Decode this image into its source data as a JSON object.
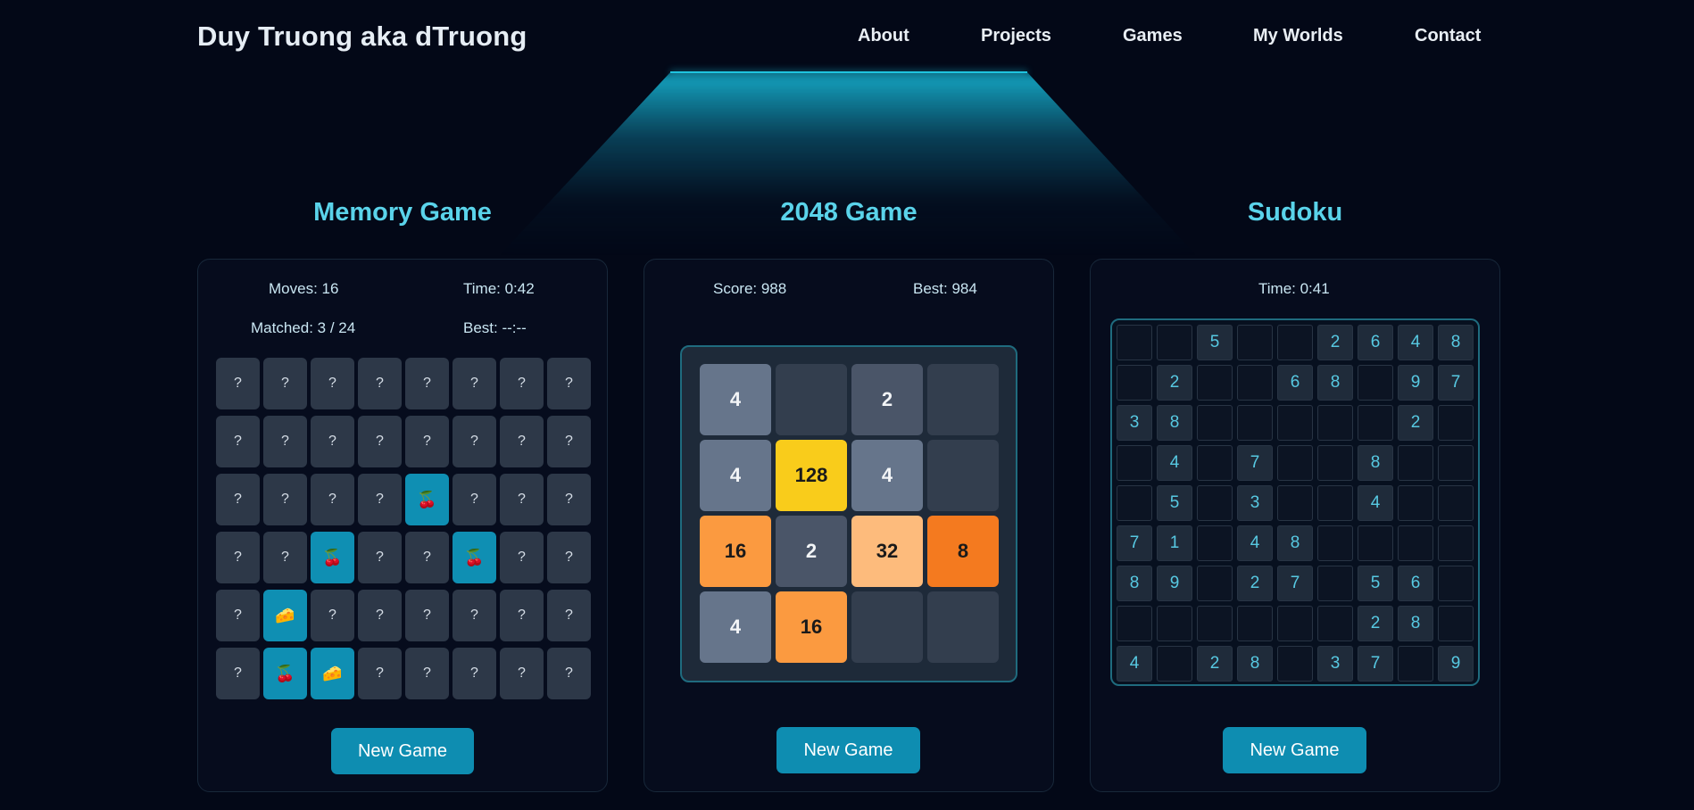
{
  "header": {
    "brand": "Duy Truong aka dTruong",
    "nav": [
      "About",
      "Projects",
      "Games",
      "My Worlds",
      "Contact"
    ]
  },
  "colors": {
    "background": "#030817",
    "accent": "#5ad3ea",
    "button": "#0e8db1",
    "card_back": "#2d3848",
    "card_flipped": "#0f8fb3"
  },
  "memory": {
    "title": "Memory Game",
    "moves": "Moves: 16",
    "time": "Time: 0:42",
    "matched": "Matched: 3 / 24",
    "best": "Best: --:--",
    "new_game": "New Game",
    "cards": [
      [
        "?",
        "?",
        "?",
        "?",
        "?",
        "?",
        "?",
        "?"
      ],
      [
        "?",
        "?",
        "?",
        "?",
        "?",
        "?",
        "?",
        "?"
      ],
      [
        "?",
        "?",
        "?",
        "?",
        "🍒",
        "?",
        "?",
        "?"
      ],
      [
        "?",
        "?",
        "🍒",
        "?",
        "?",
        "🍒",
        "?",
        "?"
      ],
      [
        "?",
        "🧀",
        "?",
        "?",
        "?",
        "?",
        "?",
        "?"
      ],
      [
        "?",
        "🍒",
        "🧀",
        "?",
        "?",
        "?",
        "?",
        "?"
      ]
    ]
  },
  "game2048": {
    "title": "2048 Game",
    "score": "Score: 988",
    "best": "Best: 984",
    "new_game": "New Game",
    "tiles": [
      [
        "4",
        "",
        "2",
        ""
      ],
      [
        "4",
        "128",
        "4",
        ""
      ],
      [
        "16",
        "2",
        "32",
        "8"
      ],
      [
        "4",
        "16",
        "",
        ""
      ]
    ]
  },
  "sudoku": {
    "title": "Sudoku",
    "time": "Time: 0:41",
    "new_game": "New Game",
    "cells": [
      [
        "",
        "",
        "5",
        "",
        "",
        "2",
        "6",
        "4",
        "8"
      ],
      [
        "",
        "2",
        "",
        "",
        "6",
        "8",
        "",
        "9",
        "7"
      ],
      [
        "3",
        "8",
        "",
        "",
        "",
        "",
        "",
        "2",
        ""
      ],
      [
        "",
        "4",
        "",
        "7",
        "",
        "",
        "8",
        "",
        ""
      ],
      [
        "",
        "5",
        "",
        "3",
        "",
        "",
        "4",
        "",
        ""
      ],
      [
        "7",
        "1",
        "",
        "4",
        "8",
        "",
        "",
        "",
        ""
      ],
      [
        "8",
        "9",
        "",
        "2",
        "7",
        "",
        "5",
        "6",
        ""
      ],
      [
        "",
        "",
        "",
        "",
        "",
        "",
        "2",
        "8",
        ""
      ],
      [
        "4",
        "",
        "2",
        "8",
        "",
        "3",
        "7",
        "",
        "9"
      ]
    ]
  }
}
